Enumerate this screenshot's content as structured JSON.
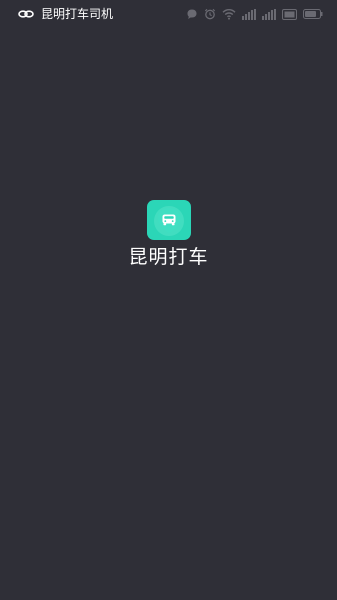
{
  "status_bar": {
    "app_title": "昆明打车司机",
    "battery_level_text": "70"
  },
  "splash": {
    "app_name": "昆明打车"
  },
  "colors": {
    "background": "#2f2f37",
    "icon_accent": "#2bd6b7",
    "status_icons": "#6a6a72"
  },
  "icons": {
    "status_left": "link-icon",
    "status_right": [
      "message-bubble-icon",
      "alarm-clock-icon",
      "wifi-icon",
      "signal-icon",
      "signal-icon",
      "hd-badge-icon",
      "battery-icon"
    ],
    "app": "car-icon"
  }
}
